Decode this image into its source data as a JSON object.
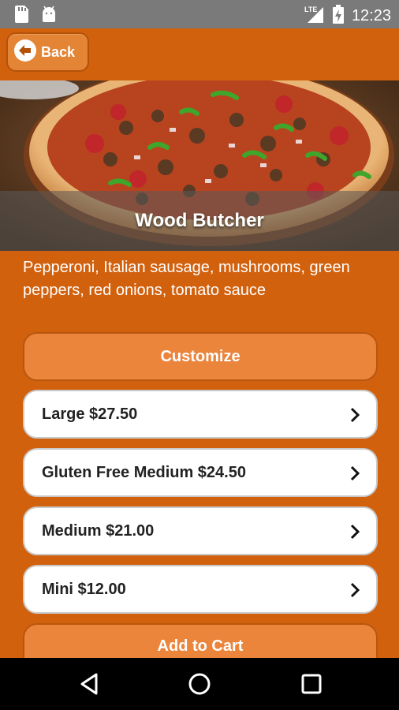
{
  "status_bar": {
    "time": "12:23",
    "network": "LTE",
    "icons": [
      "sd-card-icon",
      "android-icon",
      "signal-icon",
      "battery-icon"
    ]
  },
  "header": {
    "back_label": "Back"
  },
  "product": {
    "name": "Wood Butcher",
    "description": "Pepperoni, Italian sausage, mushrooms, green peppers, red onions, tomato sauce"
  },
  "actions": {
    "customize_label": "Customize",
    "add_to_cart_label": "Add to Cart"
  },
  "sizes": [
    {
      "label": "Large $27.50"
    },
    {
      "label": "Gluten Free Medium $24.50"
    },
    {
      "label": "Medium $21.00"
    },
    {
      "label": "Mini $12.00"
    }
  ],
  "nav": {
    "icons": [
      "back-triangle-icon",
      "home-circle-icon",
      "recents-square-icon"
    ]
  },
  "colors": {
    "background": "#D2610E",
    "button_orange": "#EB853C",
    "status_bar": "#7A7A7A",
    "nav_bar": "#000000"
  }
}
